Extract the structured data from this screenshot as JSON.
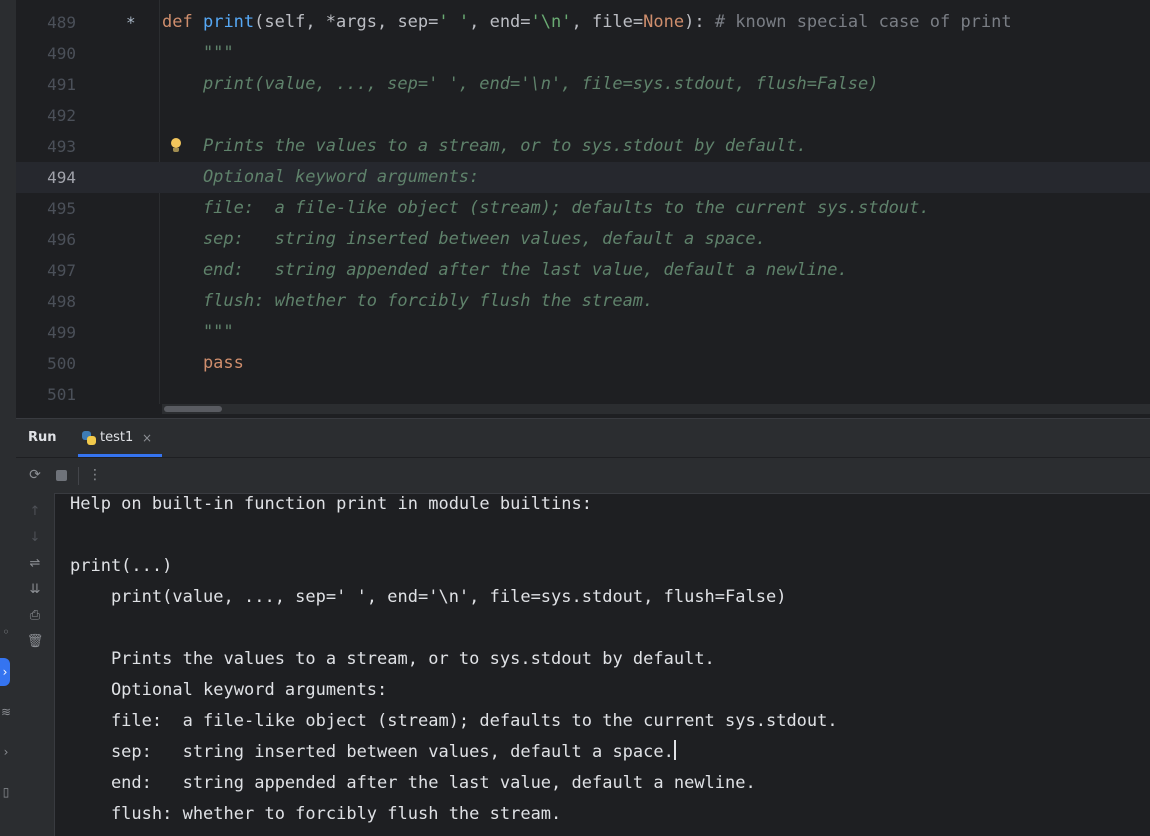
{
  "editor": {
    "lines": [
      {
        "num": "489",
        "kind": "def",
        "mark": "*"
      },
      {
        "num": "490",
        "kind": "doc",
        "text": "\"\"\""
      },
      {
        "num": "491",
        "kind": "doc",
        "text": "print(value, ..., sep=' ', end='\\n', file=sys.stdout, flush=False)"
      },
      {
        "num": "492",
        "kind": "empty",
        "text": ""
      },
      {
        "num": "493",
        "kind": "doc",
        "text": "Prints the values to a stream, or to sys.stdout by default.",
        "bulb": true
      },
      {
        "num": "494",
        "kind": "doc",
        "text": "Optional keyword arguments:",
        "current": true
      },
      {
        "num": "495",
        "kind": "doc",
        "text": "file:  a file-like object (stream); defaults to the current sys.stdout."
      },
      {
        "num": "496",
        "kind": "doc",
        "text": "sep:   string inserted between values, default a space."
      },
      {
        "num": "497",
        "kind": "doc",
        "text": "end:   string appended after the last value, default a newline."
      },
      {
        "num": "498",
        "kind": "doc",
        "text": "flush: whether to forcibly flush the stream."
      },
      {
        "num": "499",
        "kind": "doc",
        "text": "\"\"\""
      },
      {
        "num": "500",
        "kind": "kw",
        "text": "pass"
      },
      {
        "num": "501",
        "kind": "empty",
        "text": ""
      }
    ],
    "def_line": {
      "kw_def": "def",
      "fn_name": "print",
      "p1": "(self, *args, sep=",
      "s1": "' '",
      "p2": ", end=",
      "s2": "'\\n'",
      "p3": ", file=",
      "kw_none": "None",
      "p4": "): ",
      "comment": "# known special case of print"
    }
  },
  "run_panel": {
    "label": "Run",
    "tab": {
      "label": "test1",
      "close": "×"
    },
    "toolbar": {
      "rerun": "⟳",
      "more": "⋮"
    },
    "side": {
      "up": "↑",
      "down": "↓",
      "wrap": "⇌",
      "scroll_end": "⇊",
      "print": "⎙",
      "clear": "🗑"
    },
    "output": [
      "Help on built-in function print in module builtins:",
      "",
      "print(...)",
      "    print(value, ..., sep=' ', end='\\n', file=sys.stdout, flush=False)",
      "",
      "    Prints the values to a stream, or to sys.stdout by default.",
      "    Optional keyword arguments:",
      "    file:  a file-like object (stream); defaults to the current sys.stdout.",
      "    sep:   string inserted between values, default a space.",
      "    end:   string appended after the last value, default a newline.",
      "    flush: whether to forcibly flush the stream."
    ]
  },
  "colors": {
    "keyword": "#cf8e6d",
    "function": "#56a8f5",
    "string": "#6aab73",
    "comment": "#7a7e85",
    "docstring": "#5f826b",
    "accent": "#3574f0"
  }
}
